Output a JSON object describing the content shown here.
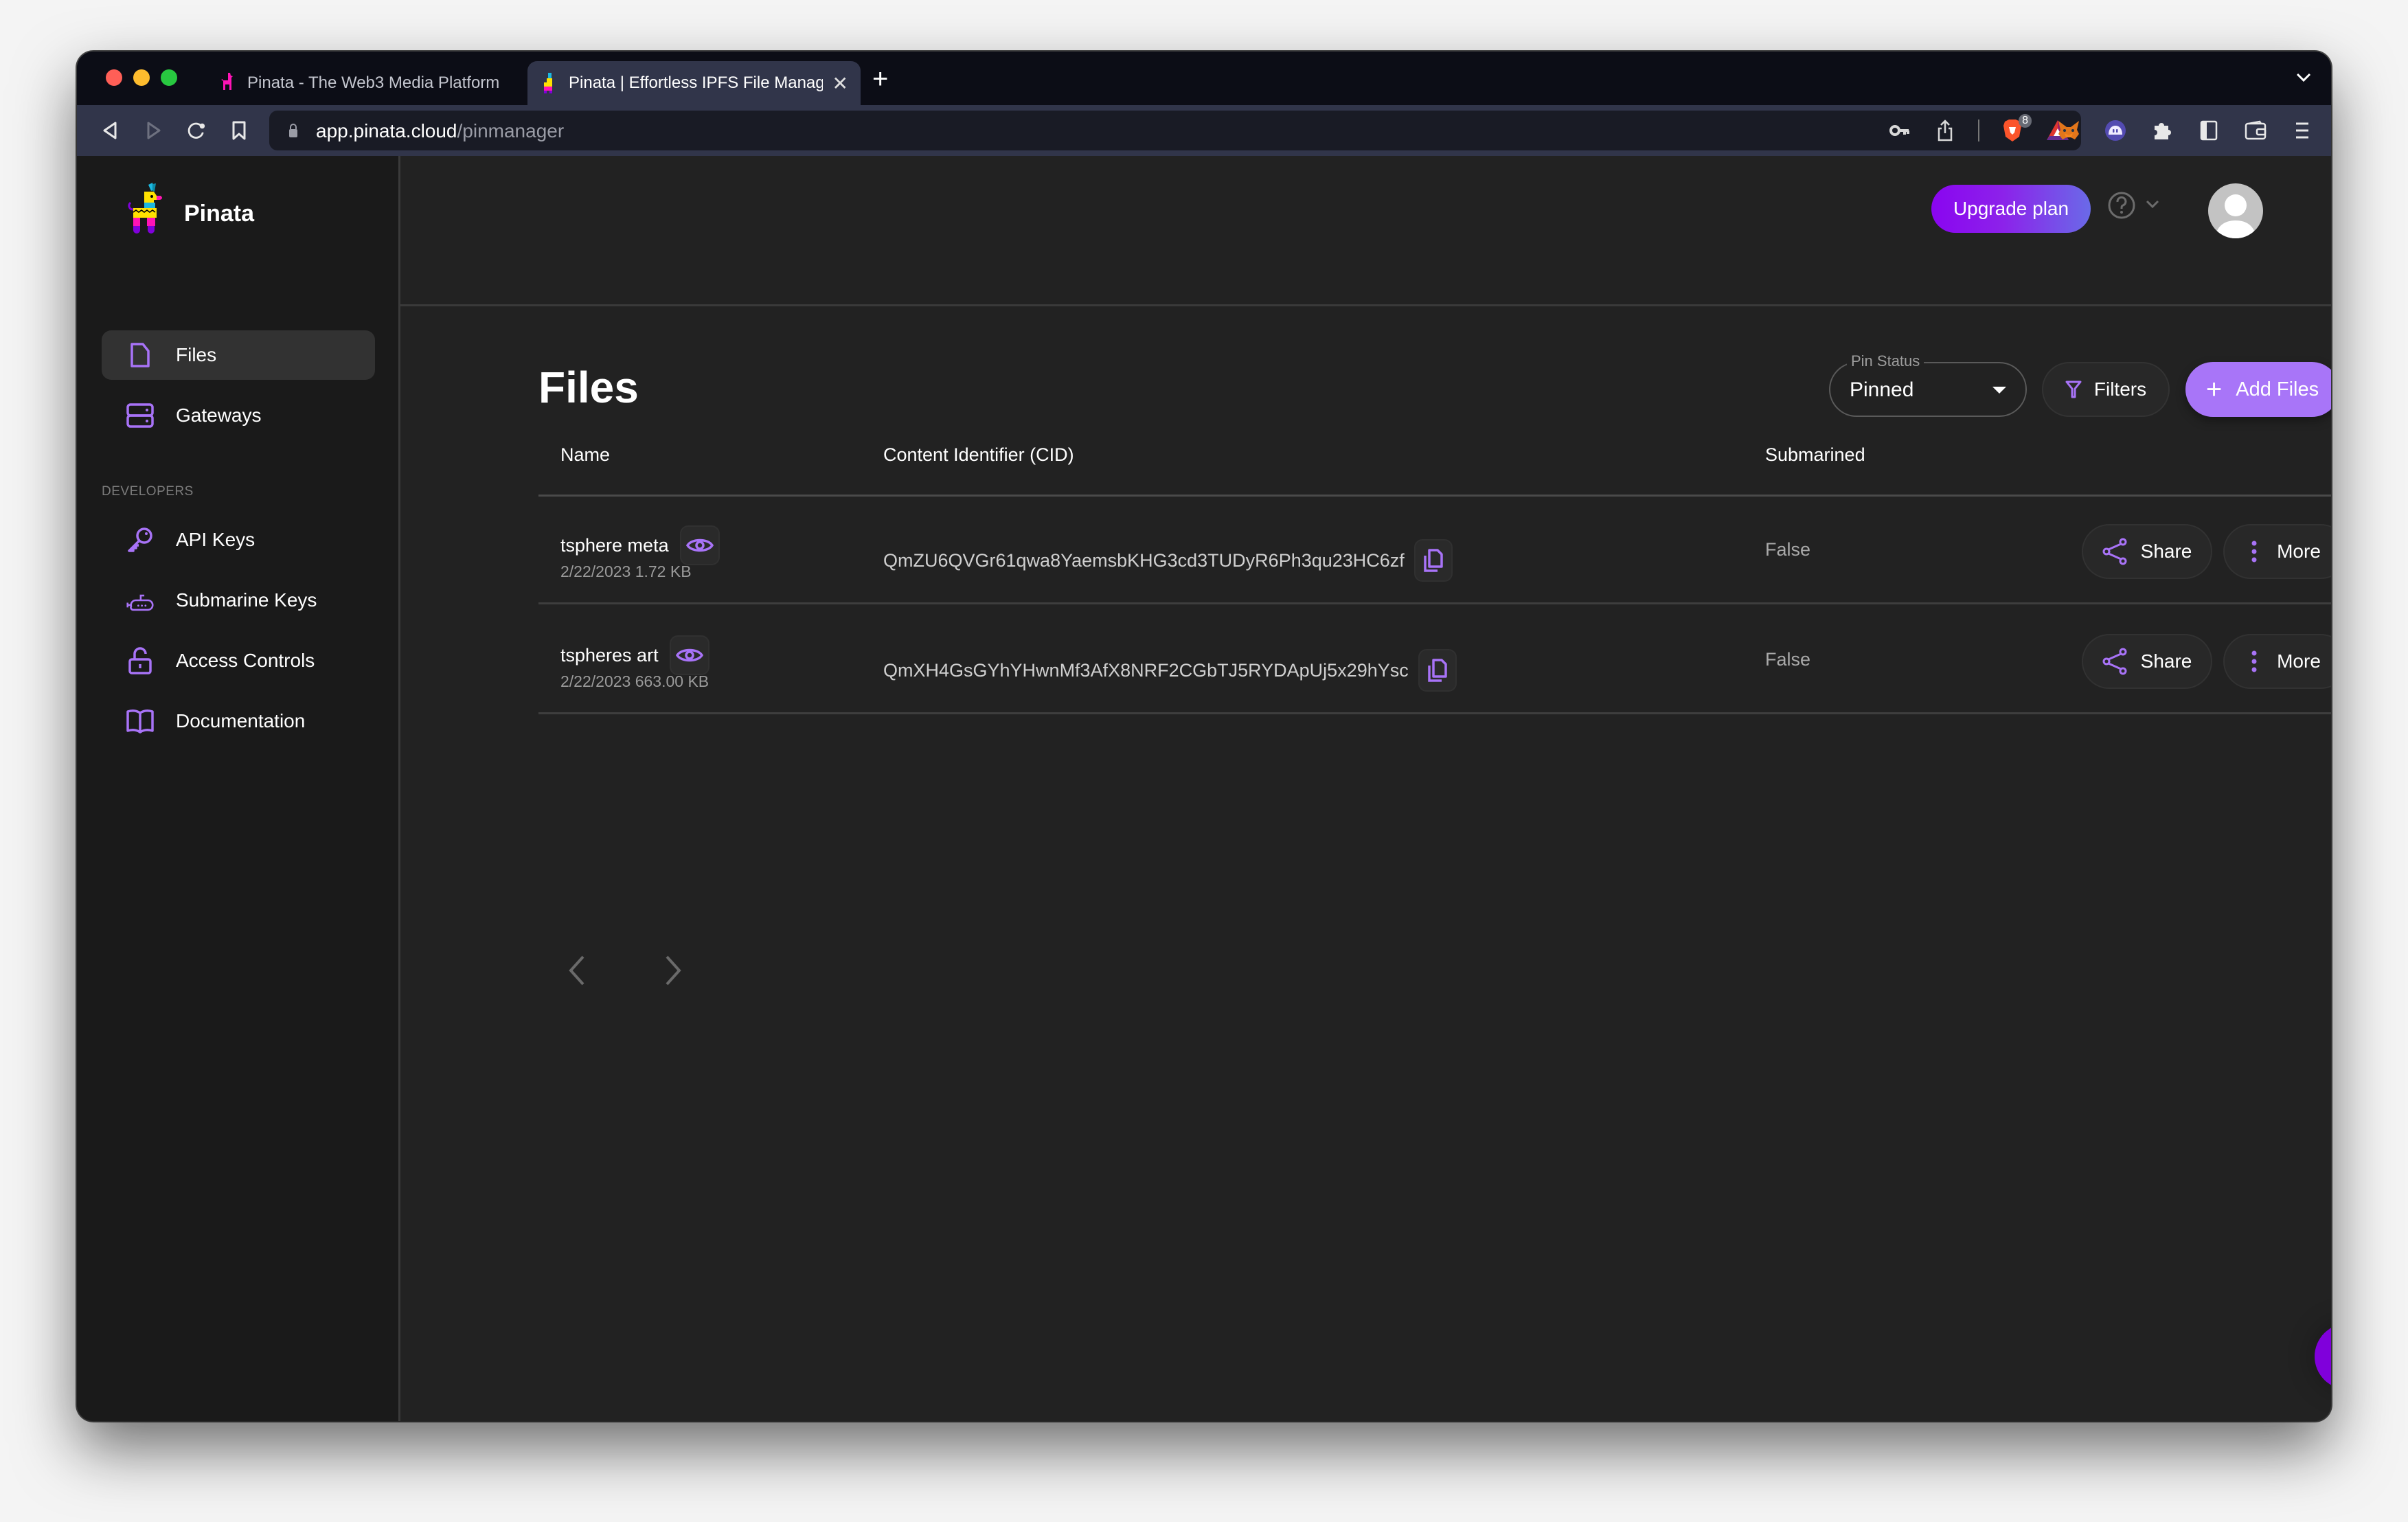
{
  "browser": {
    "tabs": [
      {
        "title": "Pinata - The Web3 Media Platform",
        "active": false
      },
      {
        "title": "Pinata | Effortless IPFS File Management",
        "active": true
      }
    ],
    "new_tab_label": "+",
    "close_tab_label": "✕",
    "url": {
      "host": "app.pinata.cloud",
      "path": "/pinmanager"
    },
    "brave_shields_count": "8",
    "icons": [
      "back-icon",
      "forward-icon",
      "reload-icon",
      "bookmark-icon",
      "lock-icon",
      "key-icon",
      "share-icon",
      "brave-shields-icon",
      "brave-rewards-icon",
      "metamask-icon",
      "phantom-icon",
      "extensions-icon",
      "sidebar-icon",
      "wallet-icon",
      "menu-icon"
    ]
  },
  "sidebar": {
    "brand": "Pinata",
    "items": [
      {
        "label": "Files",
        "icon": "file-icon",
        "active": true
      },
      {
        "label": "Gateways",
        "icon": "server-icon",
        "active": false
      }
    ],
    "developers_section": "DEVELOPERS",
    "developer_items": [
      {
        "label": "API Keys",
        "icon": "key-icon"
      },
      {
        "label": "Submarine Keys",
        "icon": "submarine-icon"
      },
      {
        "label": "Access Controls",
        "icon": "unlock-icon"
      },
      {
        "label": "Documentation",
        "icon": "book-icon"
      }
    ]
  },
  "header": {
    "upgrade_label": "Upgrade plan",
    "help_icon": "help-circle-icon",
    "avatar_icon": "user-avatar-icon"
  },
  "main": {
    "title": "Files",
    "pin_status": {
      "label": "Pin Status",
      "value": "Pinned"
    },
    "filters_label": "Filters",
    "add_files_label": "Add Files",
    "columns": [
      "Name",
      "Content Identifier (CID)",
      "Submarined"
    ],
    "rows": [
      {
        "name": "tsphere meta",
        "date": "2/22/2023",
        "size": "1.72 KB",
        "meta": "2/22/2023 1.72 KB",
        "cid": "QmZU6QVGr61qwa8YaemsbKHG3cd3TUDyR6Ph3qu23HC6zf",
        "submarined": "False",
        "share_label": "Share",
        "more_label": "More"
      },
      {
        "name": "tspheres art",
        "date": "2/22/2023",
        "size": "663.00 KB",
        "meta": "2/22/2023 663.00 KB",
        "cid": "QmXH4GsGYhYHwnMf3AfX8NRF2CGbTJ5RYDApUj5x29hYsc",
        "submarined": "False",
        "share_label": "Share",
        "more_label": "More"
      }
    ]
  },
  "colors": {
    "accent": "#a875f8",
    "accent_dark": "#8000db",
    "sidebar_bg": "#1a1a1a",
    "main_bg": "#222222"
  }
}
